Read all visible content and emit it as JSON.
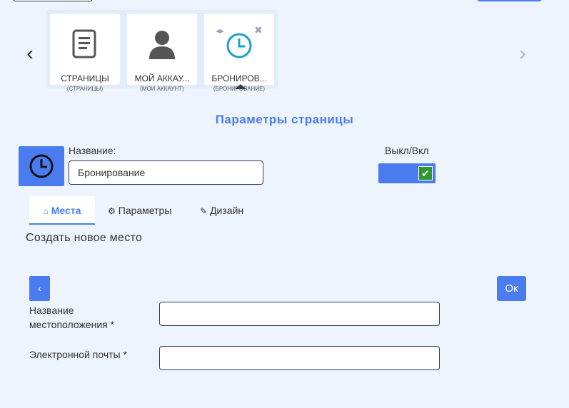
{
  "carousel": {
    "cards": [
      {
        "label": "СТРАНИЦЫ",
        "sub": "(СТРАНИЦЫ)",
        "icon": "document-icon"
      },
      {
        "label": "МОЙ АККАУ...",
        "sub": "(МОИ АККАУНТ)",
        "icon": "user-icon"
      },
      {
        "label": "БРОНИРОВ...",
        "sub": "(БРОНИРОВАНИЕ)",
        "icon": "clock-icon"
      }
    ],
    "move_glyph": "◂▸",
    "close_glyph": "✖",
    "prev_glyph": "‹",
    "next_glyph": "›"
  },
  "section_title": "Параметры страницы",
  "page": {
    "name_label": "Название:",
    "name_value": "Бронирование",
    "toggle_label": "Выкл/Вкл",
    "toggle_checked": true,
    "toggle_glyph": "✔",
    "icon": "clock-icon",
    "accent": "#4a7cf0"
  },
  "tabs": [
    {
      "label": "Места",
      "icon": "home-icon",
      "glyph": "⌂",
      "active": true
    },
    {
      "label": "Параметры",
      "icon": "gears-icon",
      "glyph": "⚙",
      "active": false
    },
    {
      "label": "Дизайн",
      "icon": "pencil-icon",
      "glyph": "✎",
      "active": false
    }
  ],
  "form": {
    "title": "Создать новое место",
    "back_label": "‹",
    "ok_label": "Ок",
    "fields": [
      {
        "label": "Название местоположения *",
        "value": ""
      },
      {
        "label": "Электронной почты *",
        "value": ""
      }
    ]
  }
}
